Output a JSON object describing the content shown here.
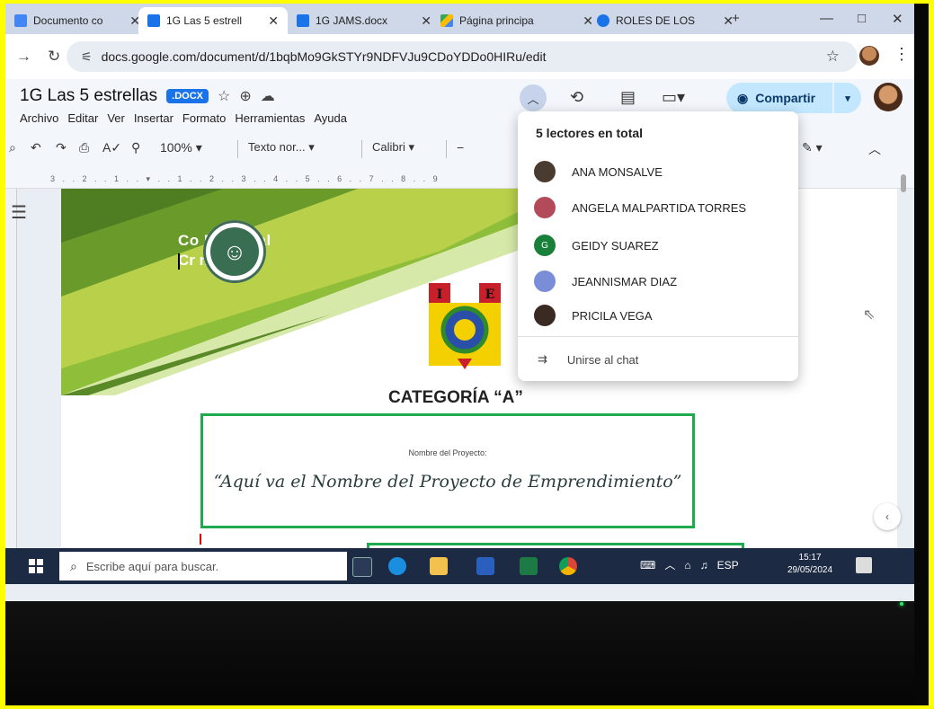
{
  "tabs": [
    {
      "title": "Documento co",
      "close": "✕"
    },
    {
      "title": "1G Las 5 estrell",
      "close": "✕"
    },
    {
      "title": "1G JAMS.docx",
      "close": "✕"
    },
    {
      "title": "Página principa",
      "close": "✕"
    },
    {
      "title": "ROLES DE LOS",
      "close": "✕"
    }
  ],
  "new_tab": "+",
  "window_controls": {
    "minimize": "—",
    "maximize": "□",
    "close": "✕"
  },
  "address_bar": {
    "url": "docs.google.com/document/d/1bqbMo9GkSTYr9NDFVJu9CDoYDDo0HIRu/edit"
  },
  "doc": {
    "title": "1G Las 5 estrellas",
    "badge": ".DOCX",
    "menu": [
      "Archivo",
      "Editar",
      "Ver",
      "Insertar",
      "Formato",
      "Herramientas",
      "Ayuda"
    ],
    "toolbar": {
      "zoom": "100%",
      "style": "Texto nor...",
      "font": "Calibri"
    },
    "share_label": "Compartir"
  },
  "readers_panel": {
    "heading": "5 lectores en total",
    "readers": [
      {
        "name": "ANA MONSALVE",
        "initial": "",
        "color": "#4a3b30"
      },
      {
        "name": "ANGELA MALPARTIDA TORRES",
        "initial": "",
        "color": "#b34a5a"
      },
      {
        "name": "GEIDY SUAREZ",
        "initial": "G",
        "color": "#188038"
      },
      {
        "name": "JEANNISMAR DIAZ",
        "initial": "",
        "color": "#7a8ed8"
      },
      {
        "name": "PRICILA VEGA",
        "initial": "",
        "color": "#3a2a22"
      }
    ],
    "join_chat": "Unirse al chat"
  },
  "page": {
    "cover_line1": "Co        Nacional",
    "cover_line2": "Cr         nprende",
    "crest_letters": [
      "I",
      "E"
    ],
    "category": "CATEGORÍA “A”",
    "project_label": "Nombre del Proyecto:",
    "project_name": "“Aquí va el Nombre del Proyecto de Emprendimiento”"
  },
  "taskbar": {
    "search_placeholder": "Escribe aquí para buscar.",
    "lang": "ESP",
    "time": "15:17",
    "date": "29/05/2024"
  },
  "colors": {
    "accent": "#1a73e8",
    "share_bg": "#c2e7ff",
    "box_border": "#1faa50",
    "highlight_frame": "#ffff00"
  }
}
